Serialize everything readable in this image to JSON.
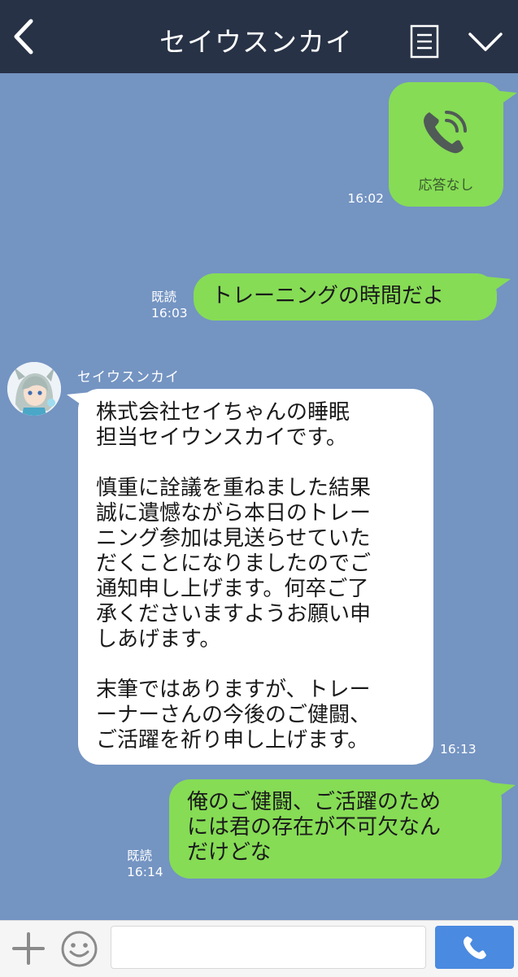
{
  "header": {
    "title": "セイウスンカイ",
    "back_icon": "chevron-left-icon",
    "menu_icon": "list-menu-icon",
    "dropdown_icon": "chevron-down-icon"
  },
  "messages": [
    {
      "type": "call",
      "side": "right",
      "label": "応答なし",
      "time": "16:02",
      "icon": "phone-call-icon"
    },
    {
      "type": "text",
      "side": "right",
      "read": "既読",
      "time": "16:03",
      "text": "トレーニングの時間だよ"
    },
    {
      "type": "text",
      "side": "left",
      "sender": "セイウスンカイ",
      "time": "16:13",
      "text": "株式会社セイちゃんの睡眠\n担当セイウンスカイです。\n\n慎重に詮議を重ねました結果\n誠に遺憾ながら本日のトレー\nニング参加は見送らせていた\nだくことになりましたのでご\n通知申し上げます。何卒ご了\n承くださいますようお願い申\nしあげます。\n\n末筆ではありますが、トレー\nーナーさんの今後のご健闘、\nご活躍を祈り申し上げます。"
    },
    {
      "type": "text",
      "side": "right",
      "read": "既読",
      "time": "16:14",
      "text": "俺のご健闘、ご活躍のため\nには君の存在が不可欠なん\nだけどな"
    }
  ],
  "input_bar": {
    "placeholder": "",
    "plus_icon": "plus-icon",
    "emoji_icon": "smiley-icon",
    "call_icon": "phone-icon"
  },
  "colors": {
    "background": "#7494c2",
    "header": "#273246",
    "bubble_sent": "#86dc55",
    "bubble_received": "#ffffff",
    "call_button": "#4a8ae0"
  }
}
